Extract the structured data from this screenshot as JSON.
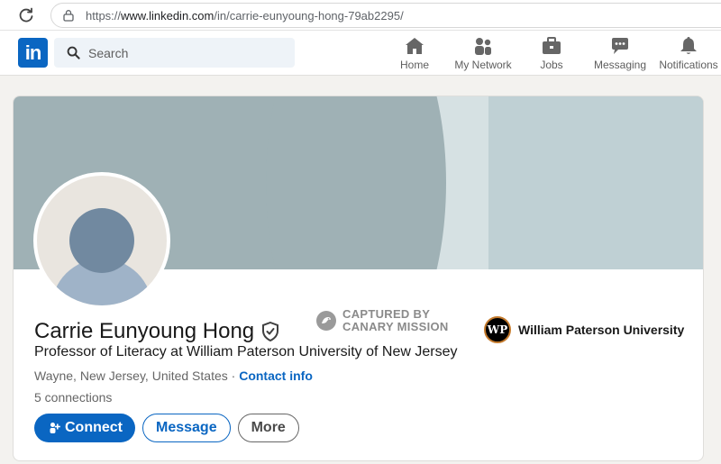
{
  "browser": {
    "url_prefix": "https://",
    "url_host": "www.linkedin.com",
    "url_path": "/in/carrie-eunyoung-hong-79ab2295/"
  },
  "nav": {
    "logo": "in",
    "search_placeholder": "Search",
    "items": [
      {
        "label": "Home",
        "icon": "home-icon"
      },
      {
        "label": "My Network",
        "icon": "network-icon"
      },
      {
        "label": "Jobs",
        "icon": "briefcase-icon"
      },
      {
        "label": "Messaging",
        "icon": "messaging-icon"
      },
      {
        "label": "Notifications",
        "icon": "bell-icon"
      }
    ]
  },
  "profile": {
    "name": "Carrie Eunyoung Hong",
    "headline": "Professor of Literacy at William Paterson University of New Jersey",
    "location": "Wayne, New Jersey, United States",
    "separator": " · ",
    "contact_label": "Contact info",
    "connections": "5 connections",
    "education": "William Paterson University",
    "education_logo": "WP"
  },
  "actions": {
    "connect": "Connect",
    "message": "Message",
    "more": "More"
  },
  "watermark": {
    "line1": "CAPTURED BY",
    "line2": "CANARY MISSION"
  },
  "colors": {
    "brand": "#0a66c2",
    "cover": "#9fb1b5"
  }
}
